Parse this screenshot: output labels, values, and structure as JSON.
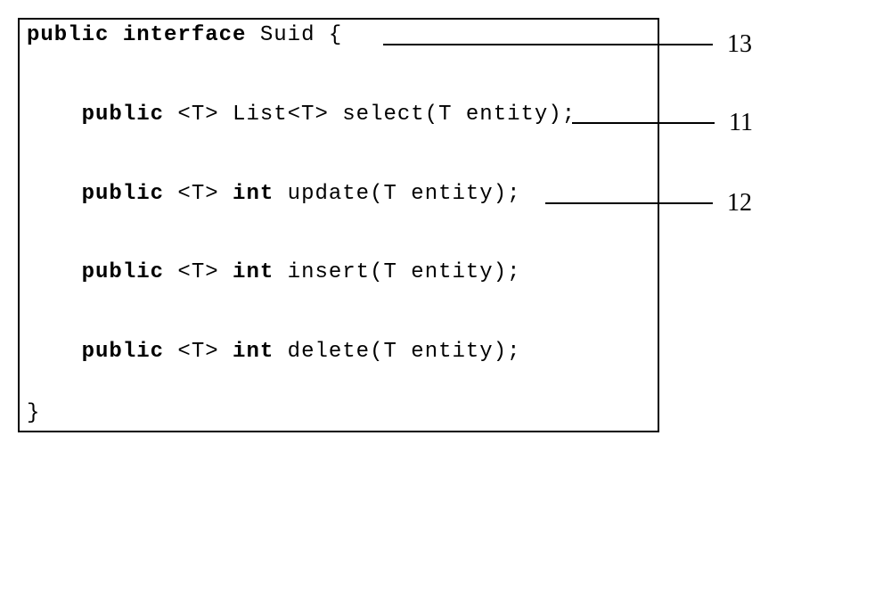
{
  "code": {
    "line1": {
      "kw1": "public",
      "kw2": "interface",
      "name": "Suid",
      "brace": " {"
    },
    "line_select": {
      "indent": "    ",
      "kw": "public",
      "generic": " <T> ",
      "type": "List<T>",
      "call": " select(T entity);"
    },
    "line_update": {
      "indent": "    ",
      "kw1": "public",
      "generic": " <T> ",
      "kw2": "int",
      "call": " update(T entity);"
    },
    "line_insert": {
      "indent": "    ",
      "kw1": "public",
      "generic": " <T> ",
      "kw2": "int",
      "call": " insert(T entity);"
    },
    "line_delete": {
      "indent": "    ",
      "kw1": "public",
      "generic": " <T> ",
      "kw2": "int",
      "call": " delete(T entity);"
    },
    "close_brace": "}"
  },
  "callouts": {
    "c13": "13",
    "c11": "11",
    "c12": "12"
  }
}
